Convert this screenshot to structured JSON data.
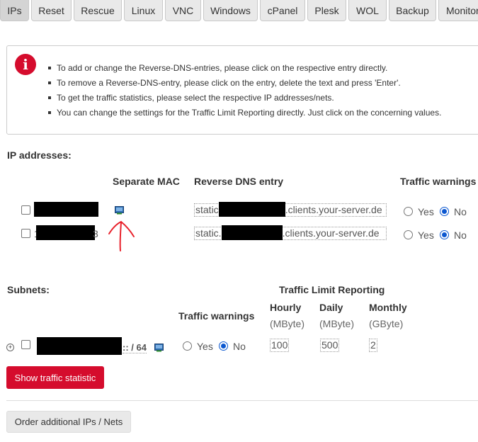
{
  "tabs": [
    {
      "label": "IPs",
      "active": true
    },
    {
      "label": "Reset"
    },
    {
      "label": "Rescue"
    },
    {
      "label": "Linux"
    },
    {
      "label": "VNC"
    },
    {
      "label": "Windows"
    },
    {
      "label": "cPanel"
    },
    {
      "label": "Plesk"
    },
    {
      "label": "WOL"
    },
    {
      "label": "Backup"
    },
    {
      "label": "Monitor"
    }
  ],
  "info": {
    "icon": "i",
    "items": [
      "To add or change the Reverse-DNS-entries, please click on the respective entry directly.",
      "To remove a Reverse-DNS-entry, please click on the entry, delete the text and press 'Enter'.",
      "To get the traffic statistics, please select the respective IP addresses/nets.",
      "You can change the settings for the Traffic Limit Reporting directly. Just click on the concerning values."
    ]
  },
  "ip_section": {
    "title": "IP addresses:",
    "columns": {
      "mac": "Separate MAC",
      "dns": "Reverse DNS entry",
      "traffic": "Traffic warnings"
    },
    "rows": [
      {
        "ip_suffix": "",
        "dns_prefix": "static",
        "dns_suffix": ".clients.your-server.de",
        "yes": "Yes",
        "no": "No",
        "selected": "No"
      },
      {
        "ip_prefix": "1",
        "ip_suffix": "3",
        "dns_prefix": "static.",
        "dns_suffix": ".clients.your-server.de",
        "yes": "Yes",
        "no": "No",
        "selected": "No"
      }
    ]
  },
  "subnet_section": {
    "title": "Subnets:",
    "limit_title": "Traffic Limit Reporting",
    "traffic_title": "Traffic warnings",
    "hourly": "Hourly",
    "hourly_unit": "(MByte)",
    "daily": "Daily",
    "daily_unit": "(MByte)",
    "monthly": "Monthly",
    "monthly_unit": "(GByte)",
    "expand": "+",
    "row": {
      "prefix_suffix": ":: / 64",
      "yes": "Yes",
      "no": "No",
      "selected": "No",
      "hourly": "100",
      "daily": "500",
      "monthly": "2"
    }
  },
  "buttons": {
    "show_traffic": "Show traffic statistic",
    "order": "Order additional IPs / Nets"
  },
  "colors": {
    "accent_red": "#d50c2d",
    "radio_blue": "#0b57d0",
    "annotation_red": "#e8212b"
  }
}
